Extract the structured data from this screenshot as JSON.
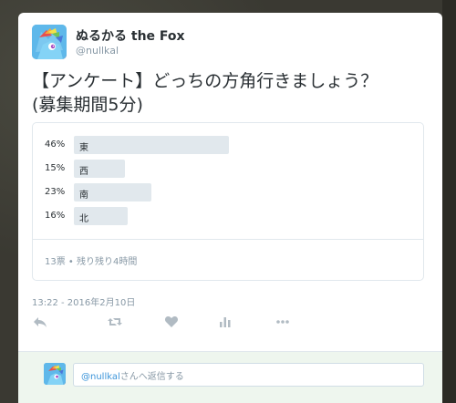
{
  "user": {
    "display_name": "ぬるかる the Fox",
    "screen_name": "@nullkal"
  },
  "tweet": {
    "text_line1": "【アンケート】どっちの方角行きましょう？",
    "text_line2": "(募集期間5分)"
  },
  "poll": {
    "choices": [
      {
        "label": "東",
        "percent_text": "46%",
        "percent": 46
      },
      {
        "label": "西",
        "percent_text": "15%",
        "percent": 15
      },
      {
        "label": "南",
        "percent_text": "23%",
        "percent": 23
      },
      {
        "label": "北",
        "percent_text": "16%",
        "percent": 16
      }
    ],
    "footer": "13票 • 残り残り4時間"
  },
  "timestamp": "13:22 - 2016年2月10日",
  "actions": {
    "reply_icon": "reply-icon",
    "retweet_icon": "retweet-icon",
    "like_icon": "heart-icon",
    "analytics_icon": "analytics-icon",
    "more_icon": "more-icon"
  },
  "reply_box": {
    "mention": "@nullkal",
    "placeholder_suffix": "さんへ返信する"
  },
  "colors": {
    "bar": "#e1e8ed",
    "muted_text": "#8899a6",
    "link": "#3b94d9",
    "reply_bg": "#eef6ee"
  }
}
